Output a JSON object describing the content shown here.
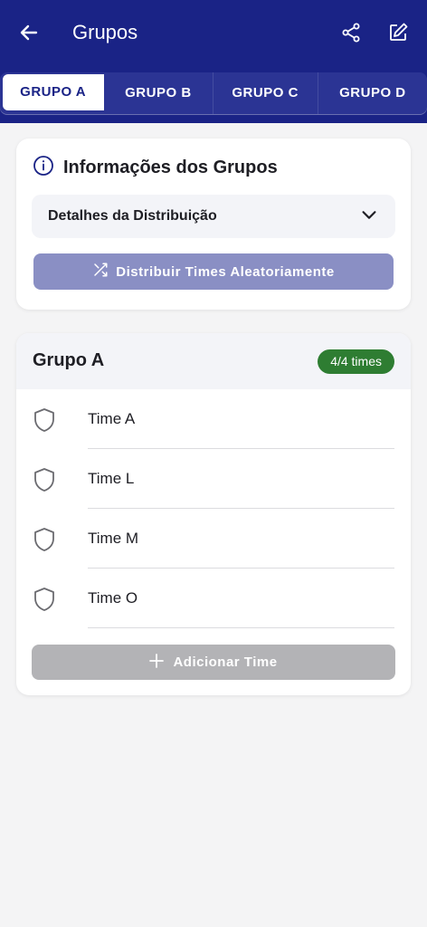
{
  "header": {
    "title": "Grupos",
    "color": "#1a2386"
  },
  "tabs": [
    {
      "label": "GRUPO A",
      "active": true
    },
    {
      "label": "GRUPO B",
      "active": false
    },
    {
      "label": "GRUPO C",
      "active": false
    },
    {
      "label": "GRUPO D",
      "active": false
    }
  ],
  "info": {
    "title": "Informações dos Grupos",
    "details_label": "Detalhes da Distribuição",
    "distribute_label": "Distribuir Times Aleatoriamente"
  },
  "group": {
    "name": "Grupo A",
    "badge": "4/4 times",
    "badge_color": "#2e7d32",
    "teams": [
      {
        "name": "Time A"
      },
      {
        "name": "Time L"
      },
      {
        "name": "Time M"
      },
      {
        "name": "Time O"
      }
    ],
    "add_label": "Adicionar Time"
  },
  "icons": [
    "back-arrow-icon",
    "share-icon",
    "edit-icon",
    "info-icon",
    "chevron-down-icon",
    "shuffle-icon",
    "shield-icon",
    "plus-icon"
  ]
}
